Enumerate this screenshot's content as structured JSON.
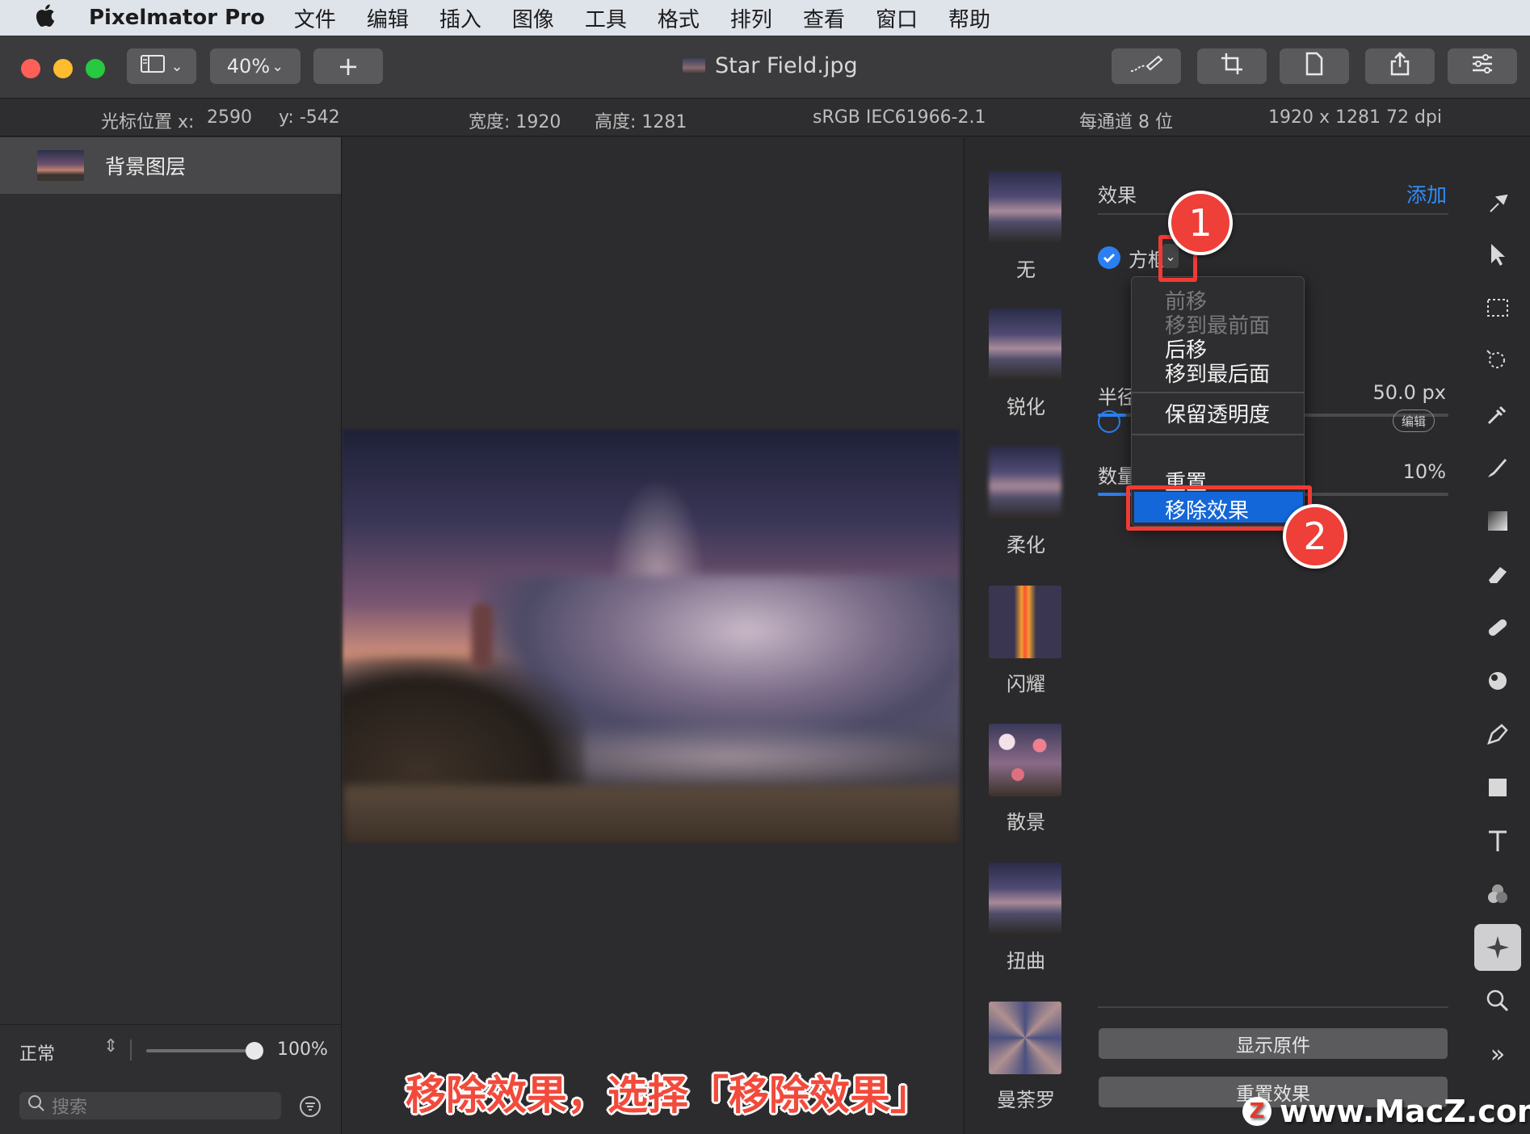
{
  "menubar": {
    "app_name": "Pixelmator Pro",
    "items": [
      "文件",
      "编辑",
      "插入",
      "图像",
      "工具",
      "格式",
      "排列",
      "查看",
      "窗口",
      "帮助"
    ]
  },
  "toolbar": {
    "zoom": "40%",
    "add_label": "+",
    "file_title": "Star Field.jpg"
  },
  "infobar": {
    "cursor_label": "光标位置 x:",
    "cursor_x": "2590",
    "cursor_y": "y:  -542",
    "width": "宽度:  1920",
    "height": "高度:  1281",
    "color_profile": "sRGB IEC61966-2.1",
    "bit_depth": "每通道 8 位",
    "dimensions": "1920 x 1281 72 dpi"
  },
  "layers": {
    "items": [
      {
        "name": "背景图层"
      }
    ],
    "blend_mode": "正常",
    "opacity_value": "100%",
    "opacity_level": 1.0,
    "search_placeholder": "搜索"
  },
  "presets": [
    {
      "label": "无"
    },
    {
      "label": "锐化"
    },
    {
      "label": "柔化"
    },
    {
      "label": "闪耀"
    },
    {
      "label": "散景"
    },
    {
      "label": "扭曲"
    },
    {
      "label": "曼荼罗"
    }
  ],
  "effects": {
    "header": "效果",
    "add_label": "添加",
    "effect1": {
      "name": "方框",
      "param_label": "半径",
      "param_value": "50.0 px",
      "checked": true,
      "level": 0.08
    },
    "effect2": {
      "param_label": "数量",
      "param_value": "10%",
      "checked": false,
      "edit_label": "编辑",
      "level": 0.1
    },
    "show_original": "显示原件",
    "reset_effects": "重置效果"
  },
  "context_menu": {
    "items": [
      {
        "label": "前移",
        "enabled": false
      },
      {
        "label": "移到最前面",
        "enabled": false
      },
      {
        "label": "后移",
        "enabled": true
      },
      {
        "label": "移到最后面",
        "enabled": true
      },
      {
        "label": "保留透明度",
        "enabled": true
      },
      {
        "label": "重置",
        "enabled": true
      },
      {
        "label": "移除效果",
        "enabled": true,
        "selected": true
      }
    ]
  },
  "annotations": {
    "step1": "1",
    "step2": "2",
    "caption": "移除效果，选择「移除效果」"
  },
  "watermark": {
    "logo_letter": "Z",
    "text": "www.MacZ.com"
  },
  "colors": {
    "accent": "#2b7ff2",
    "annotation_red": "#ee3f38",
    "traffic_close": "#fe5f57",
    "traffic_min": "#febc2e",
    "traffic_max": "#28c840"
  }
}
